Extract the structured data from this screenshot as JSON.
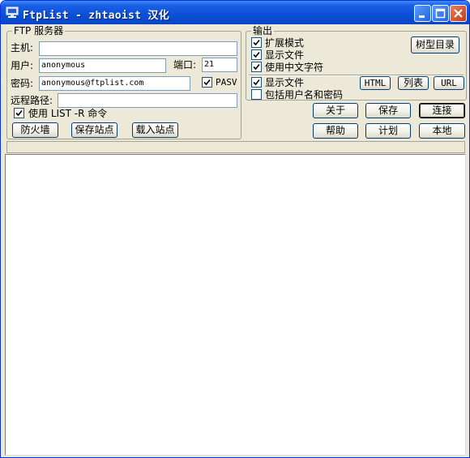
{
  "window": {
    "title": "FtpList - zhtaoist 汉化"
  },
  "ftp_server": {
    "legend": "FTP 服务器",
    "host_label": "主机:",
    "host_value": "",
    "user_label": "用户:",
    "user_value": "anonymous",
    "port_label": "端口:",
    "port_value": "21",
    "password_label": "密码:",
    "password_value": "anonymous@ftplist.com",
    "pasv_label": "PASV",
    "pasv_checked": true,
    "remote_path_label": "远程路径:",
    "remote_path_value": "",
    "list_r_label": "使用 LIST -R 命令",
    "list_r_checked": true,
    "firewall_button": "防火墙",
    "save_site_button": "保存站点",
    "load_site_button": "载入站点"
  },
  "output": {
    "legend": "输出",
    "extended_mode_label": "扩展模式",
    "extended_mode_checked": true,
    "show_files_label": "显示文件",
    "show_files_checked": true,
    "chinese_chars_label": "使用中文字符",
    "chinese_chars_checked": true,
    "tree_dir_button": "树型目录",
    "show_files2_label": "显示文件",
    "show_files2_checked": true,
    "include_credentials_label": "包括用户名和密码",
    "include_credentials_checked": false,
    "html_button": "HTML",
    "list_button": "列表",
    "url_button": "URL"
  },
  "actions": {
    "about": "关于",
    "save": "保存",
    "connect": "连接",
    "help": "帮助",
    "schedule": "计划",
    "local": "本地"
  },
  "status_bar": {
    "text": ""
  },
  "colors": {
    "title_bar": "#0a4fd6",
    "window_face": "#ece9d8",
    "check_mark": "#21a121"
  }
}
